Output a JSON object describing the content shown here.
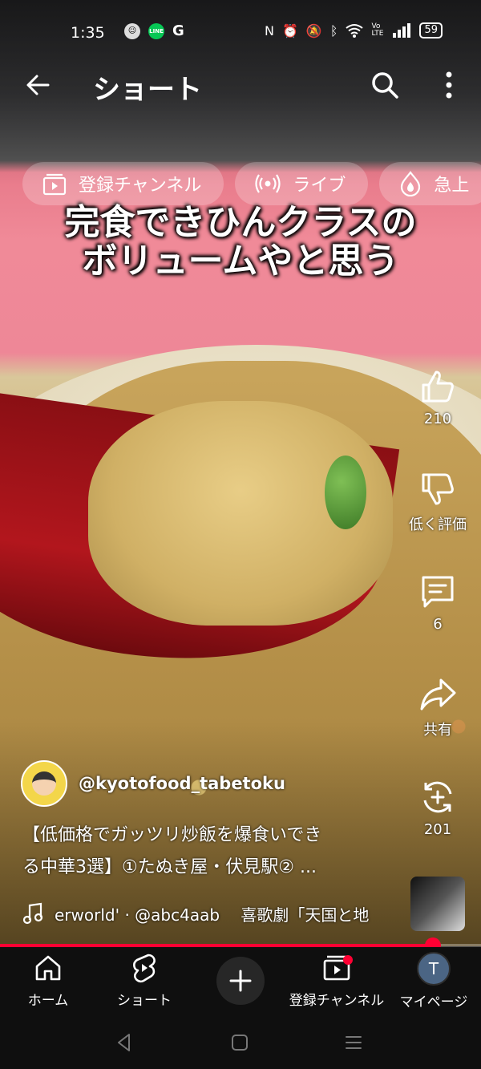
{
  "status_bar": {
    "time": "1:35",
    "battery": "59",
    "left_icons": [
      "profile-app-icon",
      "line-icon",
      "google-icon"
    ],
    "right_icons": [
      "nfc-icon",
      "alarm-icon",
      "mute-icon",
      "bluetooth-icon",
      "wifi-icon",
      "volte-icon",
      "signal-icon"
    ],
    "volte_text": "Vo LTE"
  },
  "header": {
    "title": "ショート"
  },
  "chips": [
    {
      "label": "登録チャンネル",
      "icon": "subscriptions-icon"
    },
    {
      "label": "ライブ",
      "icon": "live-icon"
    },
    {
      "label": "急上",
      "icon": "trending-icon"
    }
  ],
  "video": {
    "caption_line1": "完食できひんクラスの",
    "caption_line2": "ボリュームやと思う"
  },
  "actions": {
    "like_count": "210",
    "dislike_label": "低く評価",
    "comment_count": "6",
    "share_label": "共有",
    "remix_count": "201"
  },
  "channel": {
    "handle": "@kyotofood_tabetoku"
  },
  "description": {
    "line1": "【低価格でガッツリ炒飯を爆食いでき",
    "line2": "る中華3選】①たぬき屋・伏見駅② ..."
  },
  "music": {
    "text": "erworld' · @abc4aab　 喜歌劇「天国と地"
  },
  "progress": {
    "fraction": 0.9
  },
  "nav": {
    "home": "ホーム",
    "shorts": "ショート",
    "subscriptions": "登録チャンネル",
    "you": "マイページ",
    "avatar_letter": "T"
  },
  "colors": {
    "accent": "#ff0033",
    "nav_bg": "#0f0f0f"
  }
}
